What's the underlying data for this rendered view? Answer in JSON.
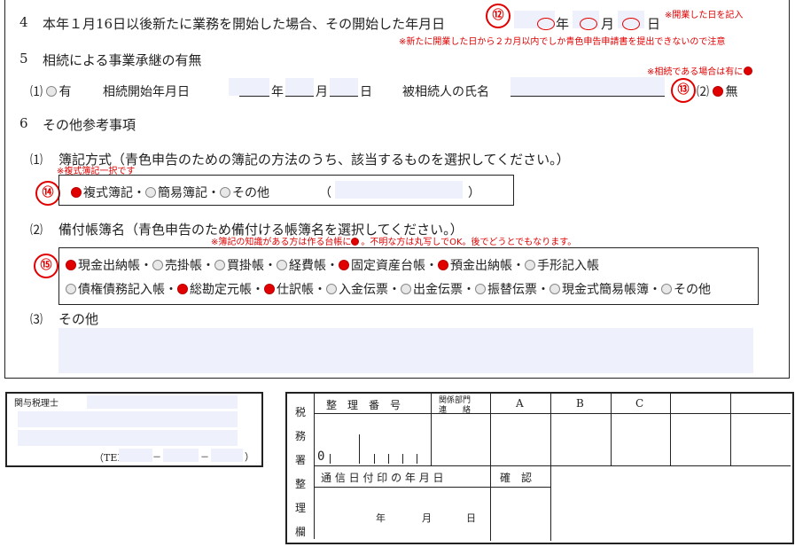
{
  "section4": {
    "number": "4",
    "text": "本年１月16日以後新たに業務を開始した場合、その開始した年月日",
    "year_label": "年",
    "month_label": "月",
    "day_label": "日",
    "circle": "⑫",
    "note1": "※開業した日を記入",
    "note2": "※新たに開業した日から２カ月以内でしか青色申告申請書を提出できないので注意"
  },
  "section5": {
    "number": "5",
    "title": "相続による事業承継の有無",
    "note": "※相続である場合は有に",
    "opt1_num": "⑴",
    "opt1_label": "有",
    "start_label": "相続開始年月日",
    "year_label": "年",
    "month_label": "月",
    "day_label": "日",
    "heir_label": "被相続人の氏名",
    "circle": "⑬",
    "opt2_num": "⑵",
    "opt2_label": "無"
  },
  "section6": {
    "number": "6",
    "title": "その他参考事項",
    "sub1": {
      "num": "⑴",
      "title": "簿記方式（青色申告のための簿記の方法のうち、該当するものを選択してください。）",
      "note": "※複式簿記一択です",
      "circle": "⑭",
      "options": [
        {
          "label": "複式簿記",
          "checked": true
        },
        {
          "label": "簡易簿記",
          "checked": false
        },
        {
          "label": "その他",
          "checked": false
        }
      ],
      "paren_open": "（",
      "paren_close": "）"
    },
    "sub2": {
      "num": "⑵",
      "title": "備付帳簿名（青色申告のため備付ける帳簿名を選択してください。）",
      "note": "※簿記の知識がある方は作る台帳に",
      "note_tail": "。不明な方は丸写しでOK。後でどうとでもなります。",
      "circle": "⑮",
      "row1": [
        {
          "label": "現金出納帳",
          "checked": true
        },
        {
          "label": "売掛帳",
          "checked": false
        },
        {
          "label": "買掛帳",
          "checked": false
        },
        {
          "label": "経費帳",
          "checked": false
        },
        {
          "label": "固定資産台帳",
          "checked": true
        },
        {
          "label": "預金出納帳",
          "checked": true
        },
        {
          "label": "手形記入帳",
          "checked": false
        }
      ],
      "row2": [
        {
          "label": "債権債務記入帳",
          "checked": false
        },
        {
          "label": "総勘定元帳",
          "checked": true
        },
        {
          "label": "仕訳帳",
          "checked": true
        },
        {
          "label": "入金伝票",
          "checked": false
        },
        {
          "label": "出金伝票",
          "checked": false
        },
        {
          "label": "振替伝票",
          "checked": false
        },
        {
          "label": "現金式簡易帳簿",
          "checked": false
        },
        {
          "label": "その他",
          "checked": false
        }
      ]
    },
    "sub3": {
      "num": "⑶",
      "title": "その他"
    }
  },
  "tax_accountant": {
    "label": "関与税理士",
    "tel_label": "（TEL",
    "dash": "－",
    "close": "）"
  },
  "office_use": {
    "side_label": [
      "税",
      "務",
      "署",
      "整",
      "理",
      "欄"
    ],
    "seiri_bango": "整　理　番　号",
    "kankei_bumon": "関係部門",
    "renraku": "連　　絡",
    "cols": [
      "A",
      "B",
      "C"
    ],
    "digit_zero": "0",
    "tsushin_label": "通 信 日 付 印 の 年 月 日",
    "kakunin": "確　認",
    "year": "年",
    "month": "月",
    "day": "日"
  }
}
